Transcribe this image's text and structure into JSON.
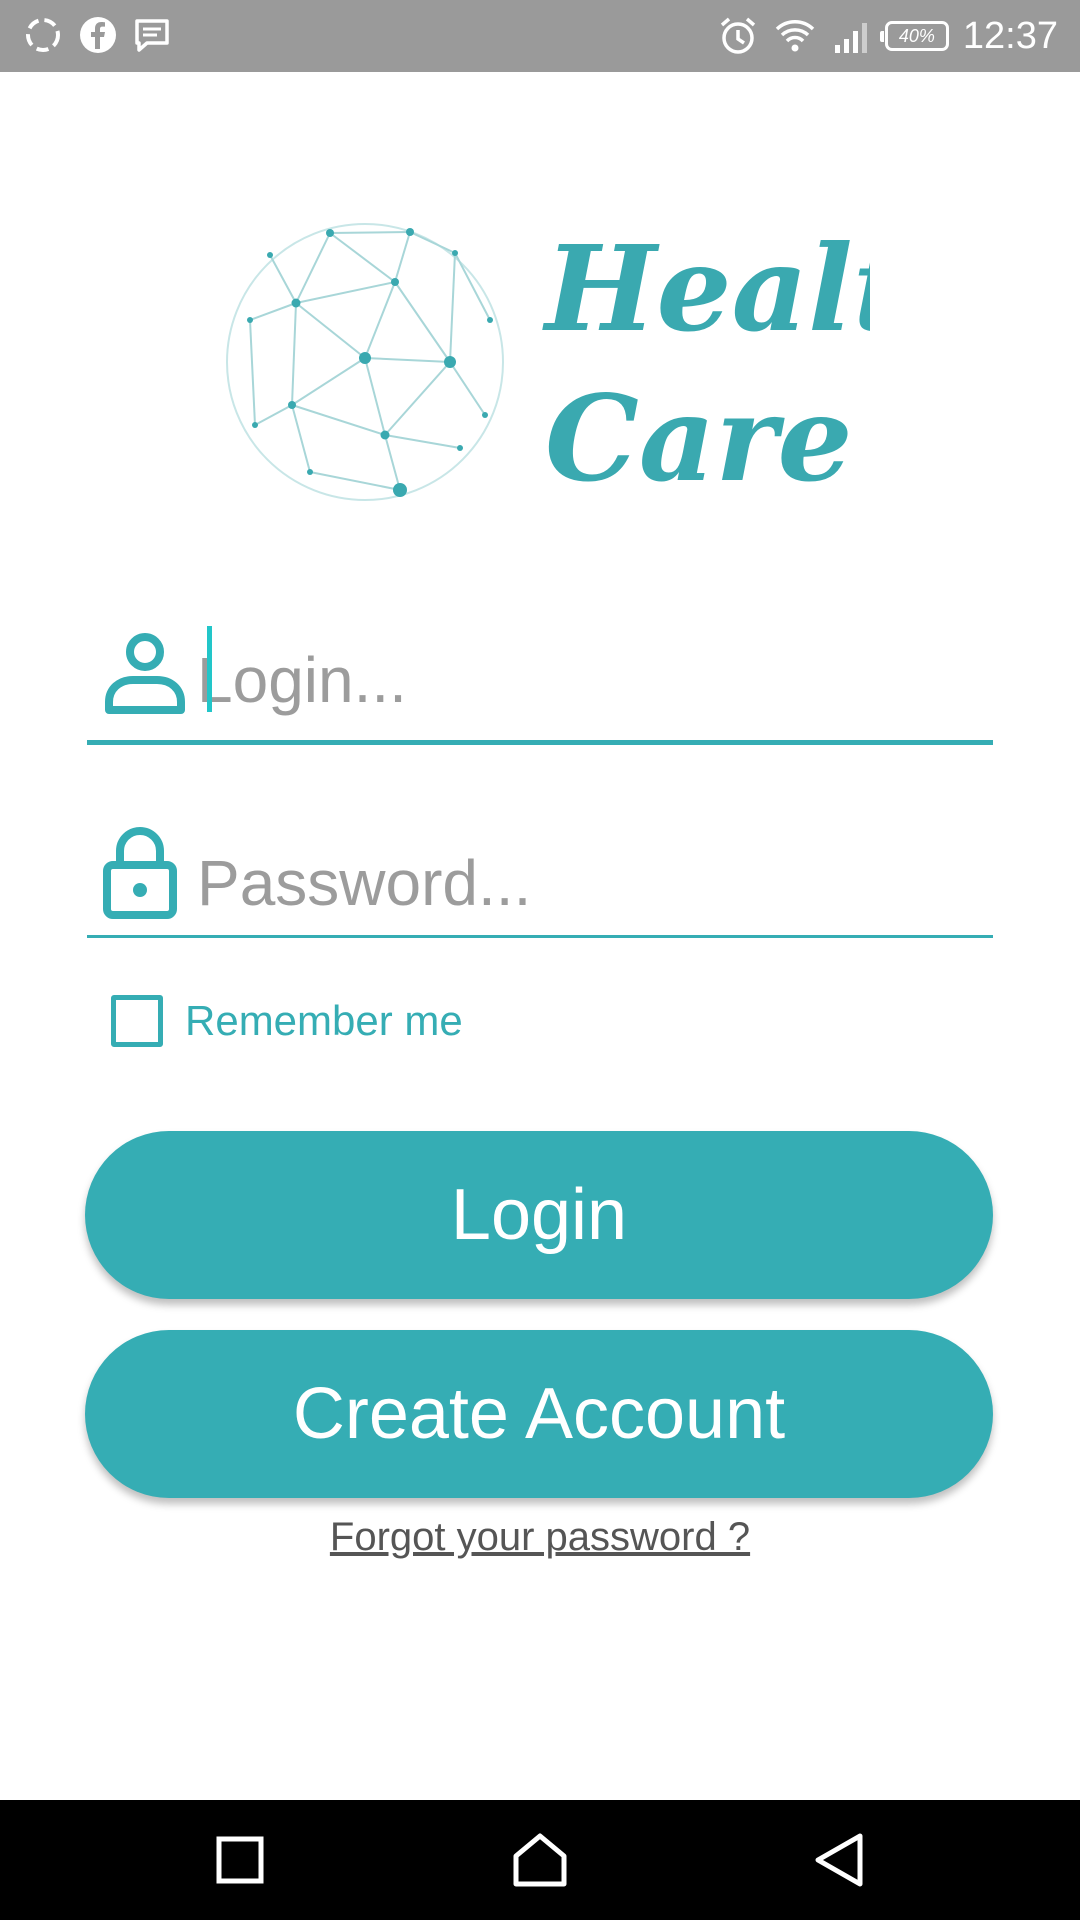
{
  "status_bar": {
    "time": "12:37",
    "battery": "40%",
    "left_icons": [
      "sync-icon",
      "facebook-icon",
      "message-icon"
    ],
    "right_icons": [
      "alarm-icon",
      "wifi-icon",
      "signal-icon",
      "battery-icon"
    ]
  },
  "logo": {
    "line1": "Health",
    "line2": "Care",
    "icon": "geodesic-sphere-icon"
  },
  "login_field": {
    "placeholder": "Login...",
    "value": "",
    "icon": "user-icon"
  },
  "password_field": {
    "placeholder": "Password...",
    "value": "",
    "icon": "lock-icon"
  },
  "remember": {
    "label": "Remember me",
    "checked": false
  },
  "buttons": {
    "login": "Login",
    "create_account": "Create Account"
  },
  "forgot_link": "Forgot your password ?",
  "nav_bar": {
    "items": [
      "recents-icon",
      "home-icon",
      "back-icon"
    ]
  },
  "colors": {
    "accent": "#35adb4",
    "status_bar": "#9a9a9a",
    "nav_bar": "#000000",
    "placeholder": "#9c9c9c"
  }
}
